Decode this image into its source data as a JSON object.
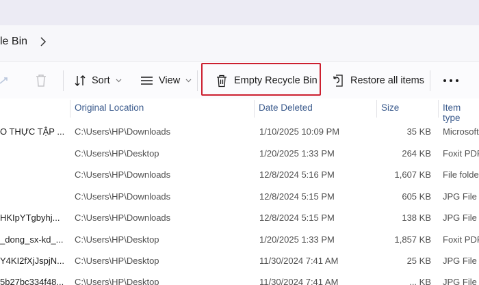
{
  "breadcrumb": {
    "current": "le Bin"
  },
  "toolbar": {
    "sort_label": "Sort",
    "view_label": "View",
    "empty_label": "Empty Recycle Bin",
    "restore_label": "Restore all items"
  },
  "columns": {
    "location": "Original Location",
    "date": "Date Deleted",
    "size": "Size",
    "type": "Item type"
  },
  "rows": [
    {
      "name": "O THỰC TẬP ...",
      "location": "C:\\Users\\HP\\Downloads",
      "date": "1/10/2025 10:09 PM",
      "size": "35 KB",
      "type": "Microsoft"
    },
    {
      "name": "",
      "location": "C:\\Users\\HP\\Desktop",
      "date": "1/20/2025 1:33 PM",
      "size": "264 KB",
      "type": "Foxit PDF"
    },
    {
      "name": "",
      "location": "C:\\Users\\HP\\Downloads",
      "date": "12/8/2024 5:16 PM",
      "size": "1,607 KB",
      "type": "File folder"
    },
    {
      "name": "",
      "location": "C:\\Users\\HP\\Downloads",
      "date": "12/8/2024 5:15 PM",
      "size": "605 KB",
      "type": "JPG File"
    },
    {
      "name": "HKIpYTgbyhj...",
      "location": "C:\\Users\\HP\\Downloads",
      "date": "12/8/2024 5:15 PM",
      "size": "138 KB",
      "type": "JPG File"
    },
    {
      "name": "_dong_sx-kd_...",
      "location": "C:\\Users\\HP\\Desktop",
      "date": "1/20/2025 1:33 PM",
      "size": "1,857 KB",
      "type": "Foxit PDF"
    },
    {
      "name": "Y4KI2fXjJspjN...",
      "location": "C:\\Users\\HP\\Desktop",
      "date": "11/30/2024 7:41 AM",
      "size": "25 KB",
      "type": "JPG File"
    },
    {
      "name": "5b27bc334f48...",
      "location": "C:\\Users\\HP\\Desktop",
      "date": "11/30/2024 7:41 AM",
      "size": "... KB",
      "type": "JPG File"
    }
  ]
}
